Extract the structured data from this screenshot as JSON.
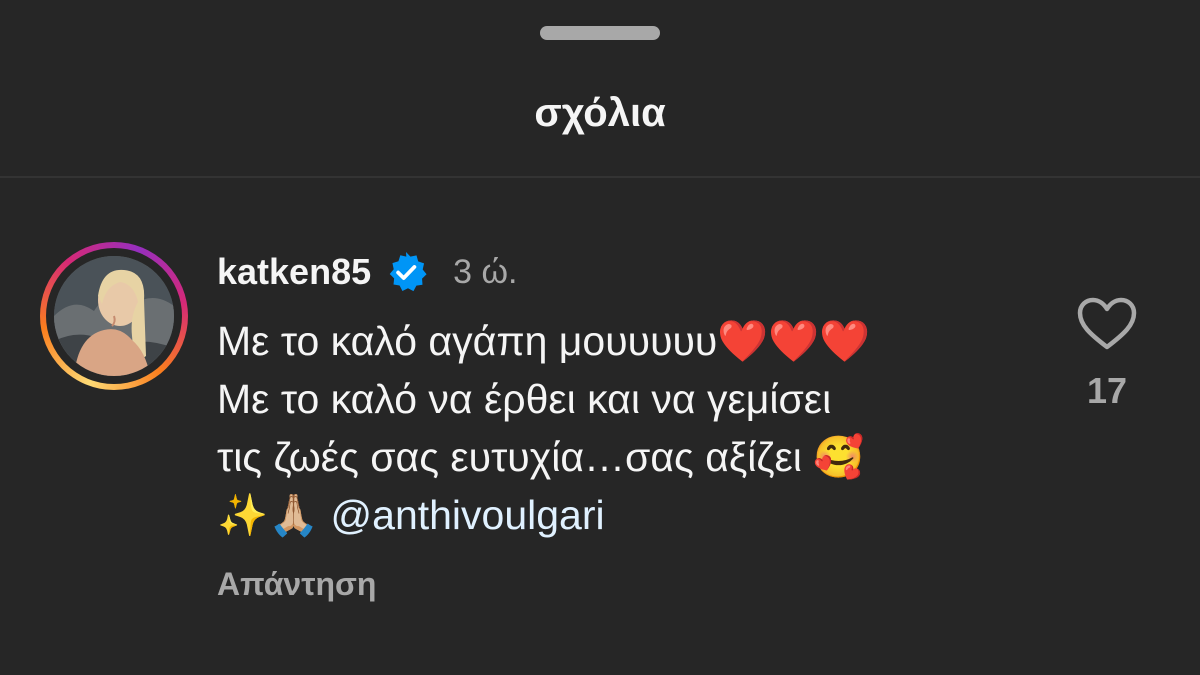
{
  "sheet": {
    "title": "σχόλια"
  },
  "comment": {
    "username": "katken85",
    "time": "3 ώ.",
    "lines": [
      "Με το καλό αγάπη μουυυυυ❤️❤️❤️",
      "Με το καλό να έρθει και να γεμίσει",
      "τις ζωές σας ευτυχία…σας αξίζει 🥰",
      "✨🙏🏼"
    ],
    "mention": "@anthivoulgari",
    "reply_label": "Απάντηση",
    "like_count": "17"
  },
  "icons": {
    "verified": "verified-badge-icon",
    "like": "heart-outline-icon"
  },
  "colors": {
    "background": "#262626",
    "text": "#f5f5f5",
    "secondary": "#a8a8a8",
    "verified": "#0095f6",
    "mention": "#e0f1ff"
  }
}
